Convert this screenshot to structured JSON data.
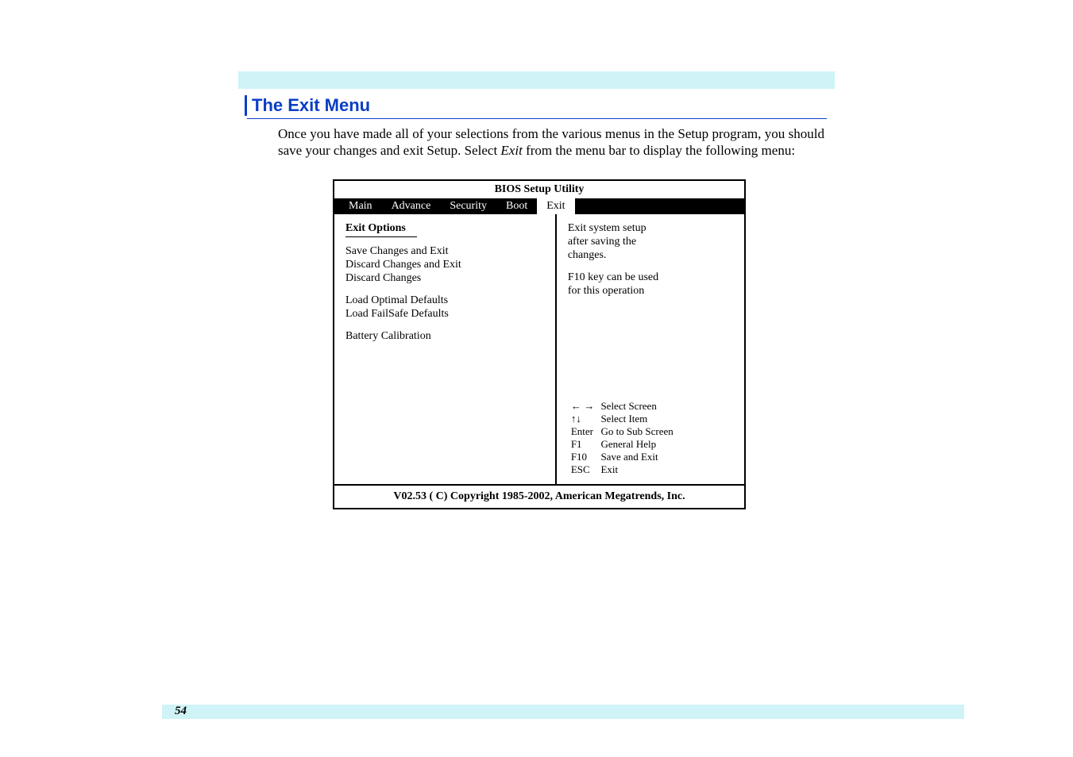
{
  "page_number": "54",
  "heading": "The Exit Menu",
  "body_part1": "Once you have made all of your selections from the various menus in the Setup program, you should save your changes and exit Setup.  Select ",
  "body_italic": "Exit",
  "body_part2": " from the menu bar to display the following menu:",
  "bios": {
    "title": "BIOS Setup Utility",
    "tabs": [
      "Main",
      "Advance",
      "Security",
      "Boot",
      "Exit"
    ],
    "active_tab_index": 4,
    "section_title": "Exit Options",
    "options": [
      "Save Changes and Exit",
      "Discard Changes and Exit",
      "Discard Changes",
      "",
      "Load Optimal Defaults",
      "Load FailSafe Defaults",
      "",
      "Battery Calibration"
    ],
    "help": [
      "Exit system setup",
      "after saving the",
      "changes.",
      "",
      "F10 key can be used",
      "for this operation"
    ],
    "nav": [
      {
        "key": "← →",
        "action": "Select Screen"
      },
      {
        "key": "↑↓",
        "action": "Select Item"
      },
      {
        "key": "Enter",
        "action": "Go to Sub Screen"
      },
      {
        "key": "F1",
        "action": "General Help"
      },
      {
        "key": "F10",
        "action": "Save and Exit"
      },
      {
        "key": "ESC",
        "action": "Exit"
      }
    ],
    "footer": "V02.53  ( C) Copyright 1985-2002, American Megatrends, Inc."
  }
}
